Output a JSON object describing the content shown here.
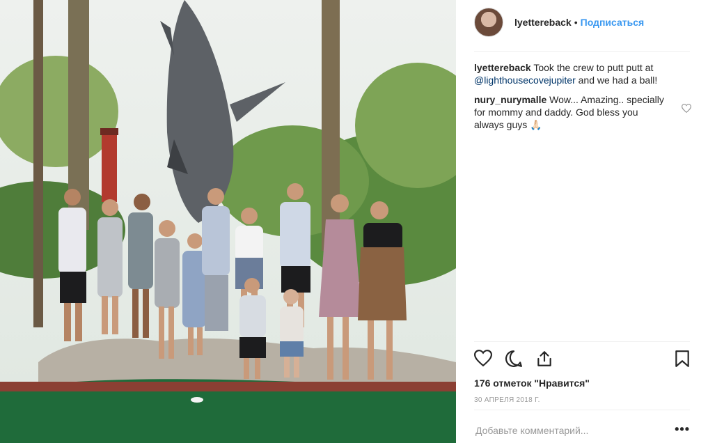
{
  "header": {
    "username": "lyettereback",
    "separator": "•",
    "follow_label": "Подписаться"
  },
  "caption": {
    "username": "lyettereback",
    "text_before": " Took the crew to putt putt at ",
    "mention": "@lighthousecovejupiter",
    "text_after": " and we had a ball!"
  },
  "comments": [
    {
      "username": "nury_nurymalle",
      "text": " Wow... Amazing.. specially for mommy and daddy. God bless you always guys ",
      "emoji": "🙏🏻"
    }
  ],
  "likes_label": "176 отметок \"Нравится\"",
  "date_label": "30 АПРЕЛЯ 2018 Г.",
  "add_comment": {
    "placeholder": "Добавьте комментарий...",
    "more_label": "•••"
  },
  "icons": {
    "like": "heart-icon",
    "comment": "comment-icon",
    "share": "share-icon",
    "save": "bookmark-icon",
    "comment_like": "heart-small-icon"
  },
  "colors": {
    "accent": "#3897f0",
    "mention": "#003569",
    "muted": "#999999"
  }
}
